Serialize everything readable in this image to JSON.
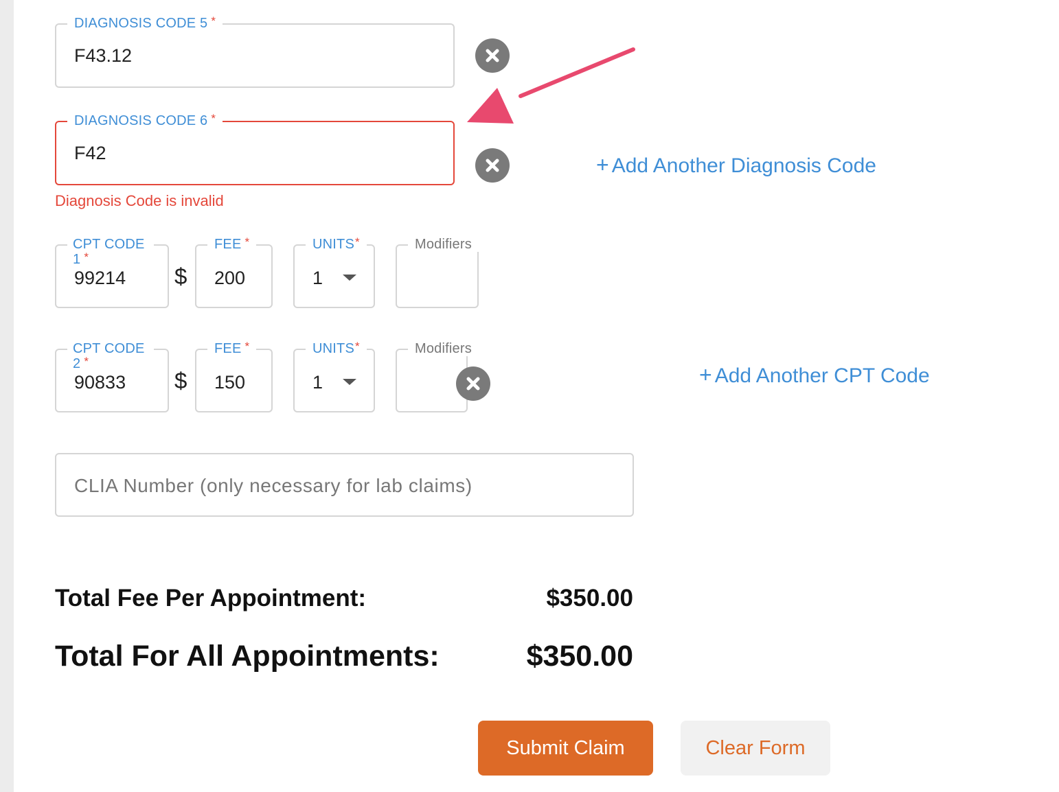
{
  "diagnosis": [
    {
      "label": "DIAGNOSIS CODE 5",
      "required": "*",
      "value": "F43.12"
    },
    {
      "label": "DIAGNOSIS CODE 6",
      "required": "*",
      "value": "F42",
      "error": "Diagnosis Code is invalid"
    }
  ],
  "add_diagnosis_label": "Add Another Diagnosis Code",
  "cpt_rows": [
    {
      "code_label": "CPT CODE 1",
      "code": "99214",
      "fee_label": "FEE",
      "fee": "200",
      "units_label": "UNITS",
      "units": "1",
      "modifiers_label": "Modifiers"
    },
    {
      "code_label": "CPT CODE 2",
      "code": "90833",
      "fee_label": "FEE",
      "fee": "150",
      "units_label": "UNITS",
      "units": "1",
      "modifiers_label": "Modifiers"
    }
  ],
  "required_mark": "*",
  "currency_symbol": "$",
  "plus_symbol": "+",
  "add_cpt_label": "Add Another CPT Code",
  "clia_placeholder": "CLIA Number (only necessary for lab claims)",
  "totals": {
    "per_appointment_label": "Total Fee Per Appointment:",
    "per_appointment_value": "$350.00",
    "all_label": "Total For All Appointments:",
    "all_value": "$350.00"
  },
  "buttons": {
    "submit": "Submit Claim",
    "clear": "Clear Form"
  },
  "colors": {
    "accent": "#3f8ed6",
    "error": "#e4473a",
    "primary": "#dd6a27",
    "annotation_arrow": "#e8496e"
  }
}
